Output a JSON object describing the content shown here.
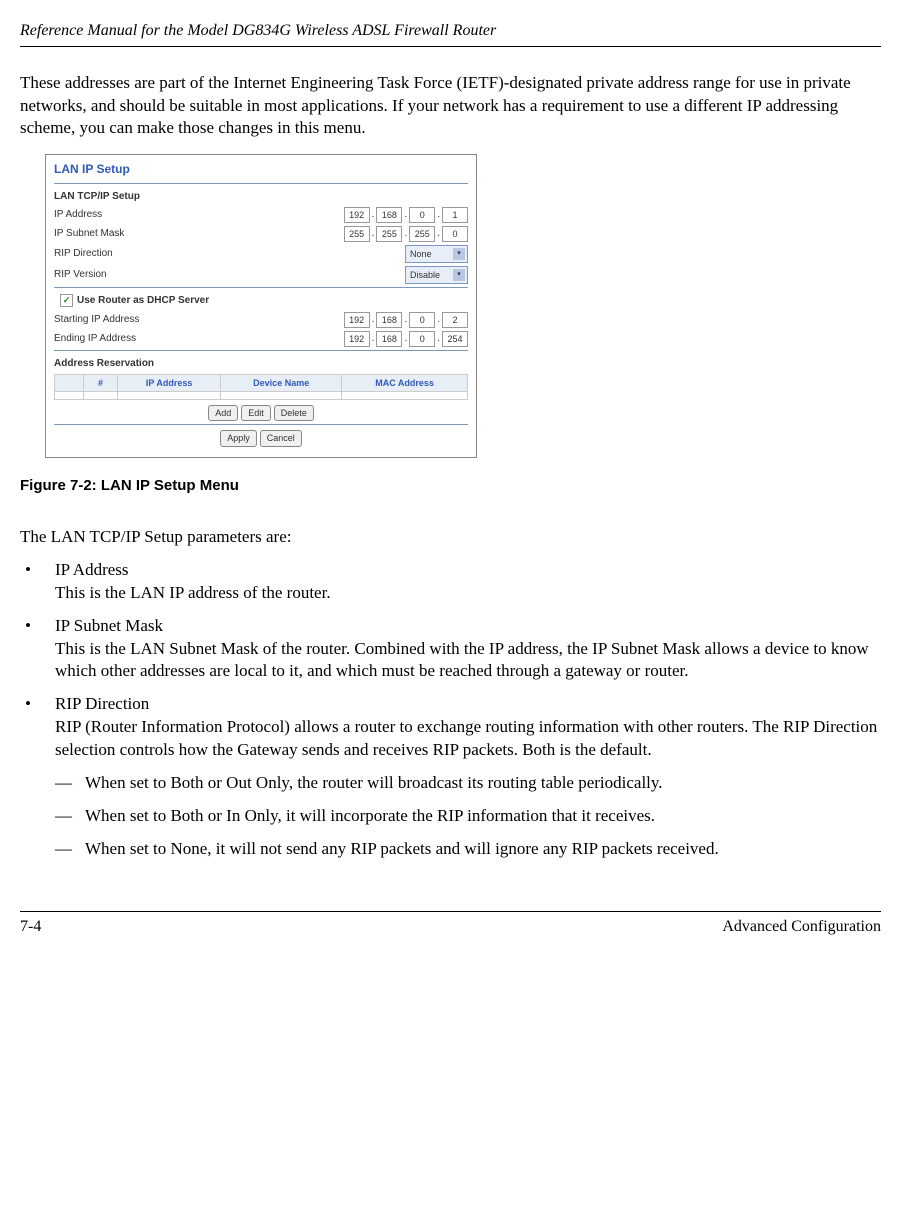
{
  "header": {
    "title": "Reference Manual for the Model DG834G Wireless ADSL Firewall Router"
  },
  "intro": "These addresses are part of the Internet Engineering Task Force (IETF)-designated private address range for use in private networks, and should be suitable in most applications. If your network has a requirement to use a different IP addressing scheme, you can make those changes in this menu.",
  "screenshot": {
    "title": "LAN IP Setup",
    "section1_label": "LAN TCP/IP Setup",
    "row_ip_label": "IP Address",
    "ip": {
      "a": "192",
      "b": "168",
      "c": "0",
      "d": "1"
    },
    "row_mask_label": "IP Subnet Mask",
    "mask": {
      "a": "255",
      "b": "255",
      "c": "255",
      "d": "0"
    },
    "row_rip_dir_label": "RIP Direction",
    "rip_dir_value": "None",
    "row_rip_ver_label": "RIP Version",
    "rip_ver_value": "Disable",
    "checkbox_label": "Use Router as DHCP Server",
    "row_start_label": "Starting IP Address",
    "start_ip": {
      "a": "192",
      "b": "168",
      "c": "0",
      "d": "2"
    },
    "row_end_label": "Ending IP Address",
    "end_ip": {
      "a": "192",
      "b": "168",
      "c": "0",
      "d": "254"
    },
    "section3_label": "Address Reservation",
    "th_num": "#",
    "th_ip": "IP Address",
    "th_device": "Device Name",
    "th_mac": "MAC Address",
    "btn_add": "Add",
    "btn_edit": "Edit",
    "btn_delete": "Delete",
    "btn_apply": "Apply",
    "btn_cancel": "Cancel"
  },
  "figure_caption": "Figure 7-2:  LAN IP Setup Menu",
  "params_intro": "The LAN TCP/IP Setup parameters are:",
  "bullets": {
    "b1_title": "IP Address",
    "b1_text": "This is the LAN IP address of the router.",
    "b2_title": "IP Subnet Mask",
    "b2_text": "This is the LAN Subnet Mask of the router. Combined with the IP address, the IP Subnet Mask allows a device to know which other addresses are local to it, and which must be reached through a gateway or router.",
    "b3_title": "RIP Direction",
    "b3_text": "RIP (Router Information Protocol) allows a router to exchange routing information with other routers. The RIP Direction selection controls how the Gateway sends and receives RIP packets. Both is the default.",
    "b3_sub1": "When set to Both or Out Only, the router will broadcast its routing table periodically.",
    "b3_sub2": "When set to Both or In Only, it will incorporate the RIP information that it receives.",
    "b3_sub3": "When set to None, it will not send any RIP packets and will ignore any RIP packets received."
  },
  "footer": {
    "page": "7-4",
    "section": "Advanced Configuration"
  }
}
